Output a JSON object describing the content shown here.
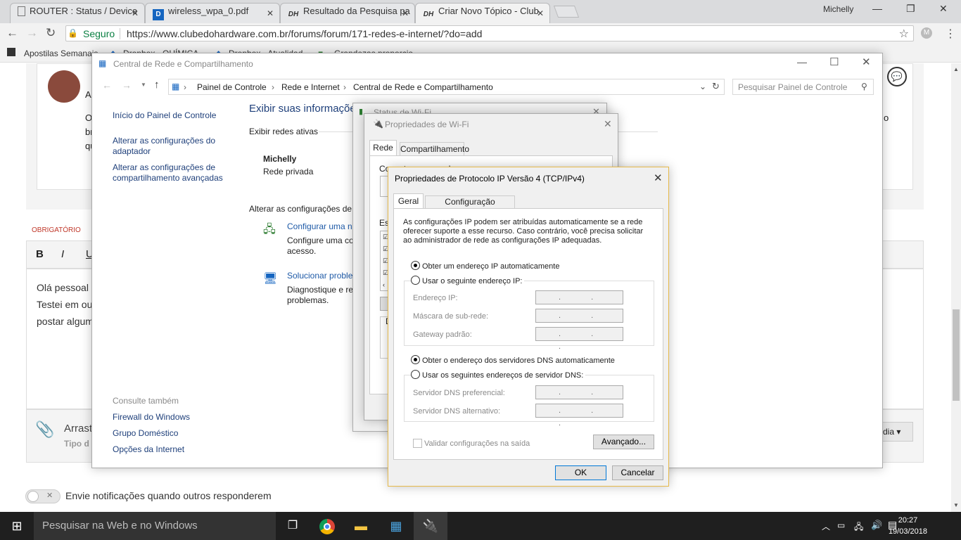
{
  "browser": {
    "tabs": [
      {
        "title": "ROUTER : Status / Device",
        "icon": "document-icon"
      },
      {
        "title": "wireless_wpa_0.pdf",
        "icon": "pdf-icon"
      },
      {
        "title": "Resultado da Pesquisa pa",
        "icon": "forum-logo-icon"
      },
      {
        "title": "Criar Novo Tópico - Club",
        "icon": "forum-logo-icon"
      }
    ],
    "user": "Michelly",
    "secure_label": "Seguro",
    "url": "https://www.clubedohardware.com.br/forums/forum/171-redes-e-internet/?do=add",
    "bookmarks": [
      "Apostilas Semanais",
      "Dropbox - QUÍMICA",
      "Dropbox - Atualidad",
      "Grandezas proporcio"
    ]
  },
  "forum": {
    "required_label": "OBRIGATÓRIO",
    "editor_buttons": [
      "B",
      "I",
      "U"
    ],
    "post_lines": [
      "Olá pessoal",
      "Testei em ou",
      "postar algum"
    ],
    "drag_text": "Arrast",
    "drag_sub": "Tipo d",
    "midia_label": "dia ▾",
    "notify_label": "Envie notificações quando outros responderem",
    "snippet_o": "o",
    "snippet_left": [
      "O",
      "br",
      "qu"
    ],
    "snippet_a": "A"
  },
  "network_center": {
    "title": "Central de Rede e Compartilhamento",
    "breadcrumb": [
      "Painel de Controle",
      "Rede e Internet",
      "Central de Rede e Compartilhamento"
    ],
    "search_placeholder": "Pesquisar Painel de Controle",
    "sidebar": [
      "Início do Painel de Controle",
      "Alterar as configurações do adaptador",
      "Alterar as configurações de compartilhamento avançadas"
    ],
    "see_also": "Consulte também",
    "see_also_links": [
      "Firewall do Windows",
      "Grupo Doméstico",
      "Opções da Internet"
    ],
    "heading": "Exibir suas informaçõe",
    "active_networks": "Exibir redes ativas",
    "network_name": "Michelly",
    "network_type": "Rede privada",
    "change_settings": "Alterar as configurações de r",
    "task1_link": "Configurar uma n",
    "task1_desc": "Configure uma co",
    "task1_desc2": "acesso.",
    "task2_link": "Solucionar proble",
    "task2_desc": "Diagnostique e rep",
    "task2_desc2": "problemas."
  },
  "wifi_status": {
    "title": "Status de Wi-Fi"
  },
  "wifi_props": {
    "title": "Propriedades de Wi-Fi",
    "tabs": [
      "Rede",
      "Compartilhamento"
    ],
    "connect_using": "Conectar-se usando:",
    "items_label": "Es",
    "desc_label": "D"
  },
  "ipv4": {
    "title": "Propriedades de Protocolo IP Versão 4 (TCP/IPv4)",
    "tabs": [
      "Geral",
      "Configuração alternativa"
    ],
    "intro": "As configurações IP podem ser atribuídas automaticamente se a rede oferecer suporte a esse recurso. Caso contrário, você precisa solicitar ao administrador de rede as configurações IP adequadas.",
    "ip_auto": "Obter um endereço IP automaticamente",
    "ip_manual": "Usar o seguinte endereço IP:",
    "ip_fields": [
      "Endereço IP:",
      "Máscara de sub-rede:",
      "Gateway padrão:"
    ],
    "dns_auto": "Obter o endereço dos servidores DNS automaticamente",
    "dns_manual": "Usar os seguintes endereços de servidor DNS:",
    "dns_fields": [
      "Servidor DNS preferencial:",
      "Servidor DNS alternativo:"
    ],
    "ip_placeholder": ". . .",
    "validate": "Validar configurações na saída",
    "advanced": "Avançado...",
    "ok": "OK",
    "cancel": "Cancelar"
  },
  "taskbar": {
    "search": "Pesquisar na Web e no Windows",
    "time": "20:27",
    "date": "19/03/2018"
  }
}
